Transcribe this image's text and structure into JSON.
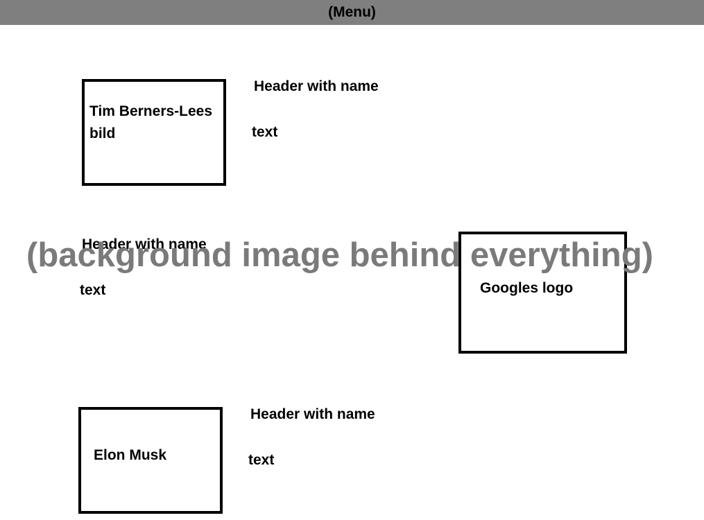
{
  "menu": {
    "label": "(Menu)"
  },
  "background": {
    "label": "(background image behind everything)"
  },
  "sections": [
    {
      "image_label": "Tim Berners-Lees bild",
      "header": "Header with name",
      "text": "text"
    },
    {
      "image_label": "Googles logo",
      "header": "Header with name",
      "text": "text"
    },
    {
      "image_label": "Elon Musk",
      "header": "Header with name",
      "text": "text"
    }
  ],
  "colors": {
    "menu_bar": "#7f7f7f",
    "background_label": "#7a7a7a",
    "box_border": "#000000"
  }
}
